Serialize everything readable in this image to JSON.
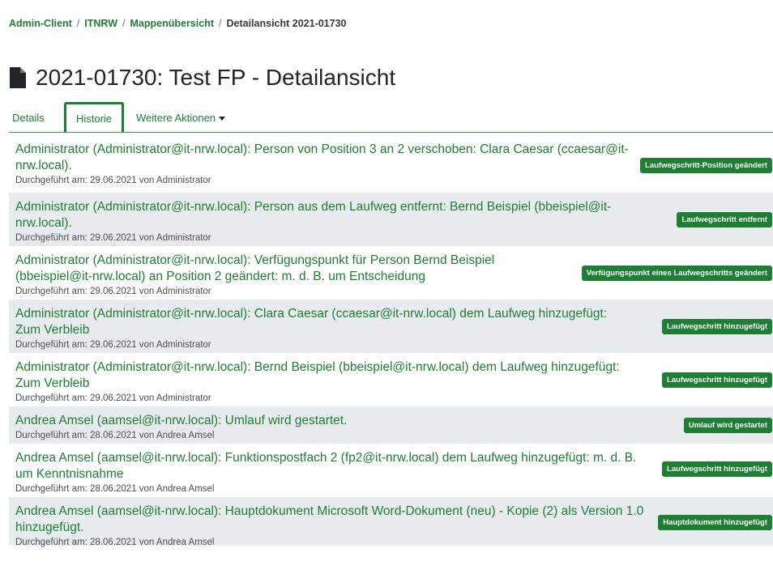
{
  "breadcrumb": {
    "items": [
      "Admin-Client",
      "ITNRW",
      "Mappenübersicht"
    ],
    "separator": "/",
    "current": "Detailansicht 2021-01730"
  },
  "title": "2021-01730: Test FP - Detailansicht",
  "tabs": {
    "details": "Details",
    "historie": "Historie",
    "more": "Weitere Aktionen"
  },
  "history": [
    {
      "message": "Administrator (Administrator@it-nrw.local): Person von Position 3 an 2 verschoben: Clara Caesar (ccaesar@it-nrw.local).",
      "meta": "Durchgeführt am: 29.06.2021 von Administrator",
      "badge": "Laufwegschritt-Position geändert"
    },
    {
      "message": "Administrator (Administrator@it-nrw.local): Person aus dem Laufweg entfernt: Bernd Beispiel (bbeispiel@it-nrw.local).",
      "meta": "Durchgeführt am: 29.06.2021 von Administrator",
      "badge": "Laufwegschritt entfernt"
    },
    {
      "message": "Administrator (Administrator@it-nrw.local): Verfügungspunkt für Person Bernd Beispiel (bbeispiel@it-nrw.local) an Position 2 geändert: m. d. B. um Entscheidung",
      "meta": "Durchgeführt am: 29.06.2021 von Administrator",
      "badge": "Verfügungspunkt eines Laufwegschritts geändert"
    },
    {
      "message": "Administrator (Administrator@it-nrw.local): Clara Caesar (ccaesar@it-nrw.local) dem Laufweg hinzugefügt: Zum Verbleib",
      "meta": "Durchgeführt am: 29.06.2021 von Administrator",
      "badge": "Laufwegschritt hinzugefügt"
    },
    {
      "message": "Administrator (Administrator@it-nrw.local): Bernd Beispiel (bbeispiel@it-nrw.local) dem Laufweg hinzugefügt: Zum Verbleib",
      "meta": "Durchgeführt am: 29.06.2021 von Administrator",
      "badge": "Laufwegschritt hinzugefügt"
    },
    {
      "message": "Andrea Amsel (aamsel@it-nrw.local): Umlauf wird gestartet.",
      "meta": "Durchgeführt am: 28.06.2021 von Andrea Amsel",
      "badge": "Umlauf wird gestartet"
    },
    {
      "message": "Andrea Amsel (aamsel@it-nrw.local): Funktionspostfach 2 (fp2@it-nrw.local) dem Laufweg hinzugefügt: m. d. B. um Kenntnisnahme",
      "meta": "Durchgeführt am: 28.06.2021 von Andrea Amsel",
      "badge": "Laufwegschritt hinzugefügt"
    },
    {
      "message": "Andrea Amsel (aamsel@it-nrw.local): Hauptdokument Microsoft Word-Dokument (neu) - Kopie (2) als Version 1.0 hinzugefügt.",
      "meta": "Durchgeführt am: 28.06.2021 von Andrea Amsel",
      "badge": "Hauptdokument hinzugefügt"
    }
  ],
  "colors": {
    "accent_green": "#1e7e34",
    "stripe_gray": "#e9ecef"
  },
  "icons": {
    "title": "file-document-icon",
    "dropdown": "caret-down-icon"
  }
}
